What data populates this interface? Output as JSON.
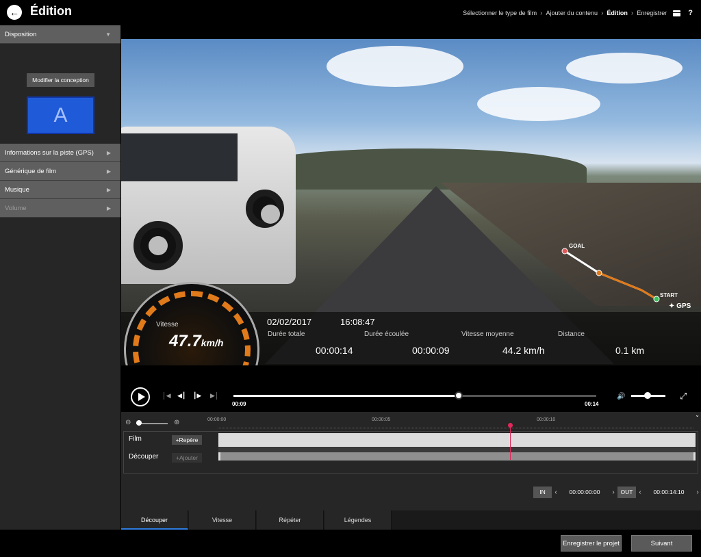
{
  "header": {
    "title": "Édition",
    "breadcrumb": [
      "Sélectionner le type de film",
      "Ajouter du contenu",
      "Édition",
      "Enregistrer"
    ],
    "breadcrumb_active_index": 2,
    "help": "?"
  },
  "sidebar": {
    "disposition": "Disposition",
    "modify_button": "Modifier la conception",
    "layout_letter": "A",
    "items": [
      {
        "label": "Informations sur la piste (GPS)",
        "enabled": true
      },
      {
        "label": "Générique de film",
        "enabled": true
      },
      {
        "label": "Musique",
        "enabled": true
      },
      {
        "label": "Volume",
        "enabled": false
      }
    ]
  },
  "video": {
    "speed_label": "Vitesse",
    "speed_value": "47.7",
    "speed_unit": "km/h",
    "date": "02/02/2017",
    "time": "16:08:47",
    "stats": [
      {
        "label": "Durée totale",
        "value": "00:00:14"
      },
      {
        "label": "Durée écoulée",
        "value": "00:00:09"
      },
      {
        "label": "Vitesse moyenne",
        "value": "44.2 km/h"
      },
      {
        "label": "Distance",
        "value": "0.1 km"
      }
    ],
    "gps_goal": "GOAL",
    "gps_start": "START",
    "gps_label": "GPS"
  },
  "player": {
    "current_time": "00:09",
    "end_time": "00:14",
    "progress": 0.621,
    "volume": 0.5
  },
  "timeline": {
    "ruler_labels": [
      "00:00:00",
      "00:00:05",
      "00:00:10"
    ],
    "tracks": [
      {
        "label": "Film",
        "button": "Repère"
      },
      {
        "label": "Découper",
        "button": "Ajouter"
      }
    ],
    "in_label": "IN",
    "in_time": "00:00:00:00",
    "out_label": "OUT",
    "out_time": "00:00:14:10"
  },
  "tabs": [
    "Découper",
    "Vitesse",
    "Répéter",
    "Légendes"
  ],
  "footer": {
    "save_project": "Enregistrer le projet",
    "next": "Suivant"
  },
  "colors": {
    "accent_blue": "#2f7de1",
    "playhead": "#e0285a",
    "layout_blue": "#1f5bd8",
    "gps_route_orange": "#e07a1a"
  }
}
